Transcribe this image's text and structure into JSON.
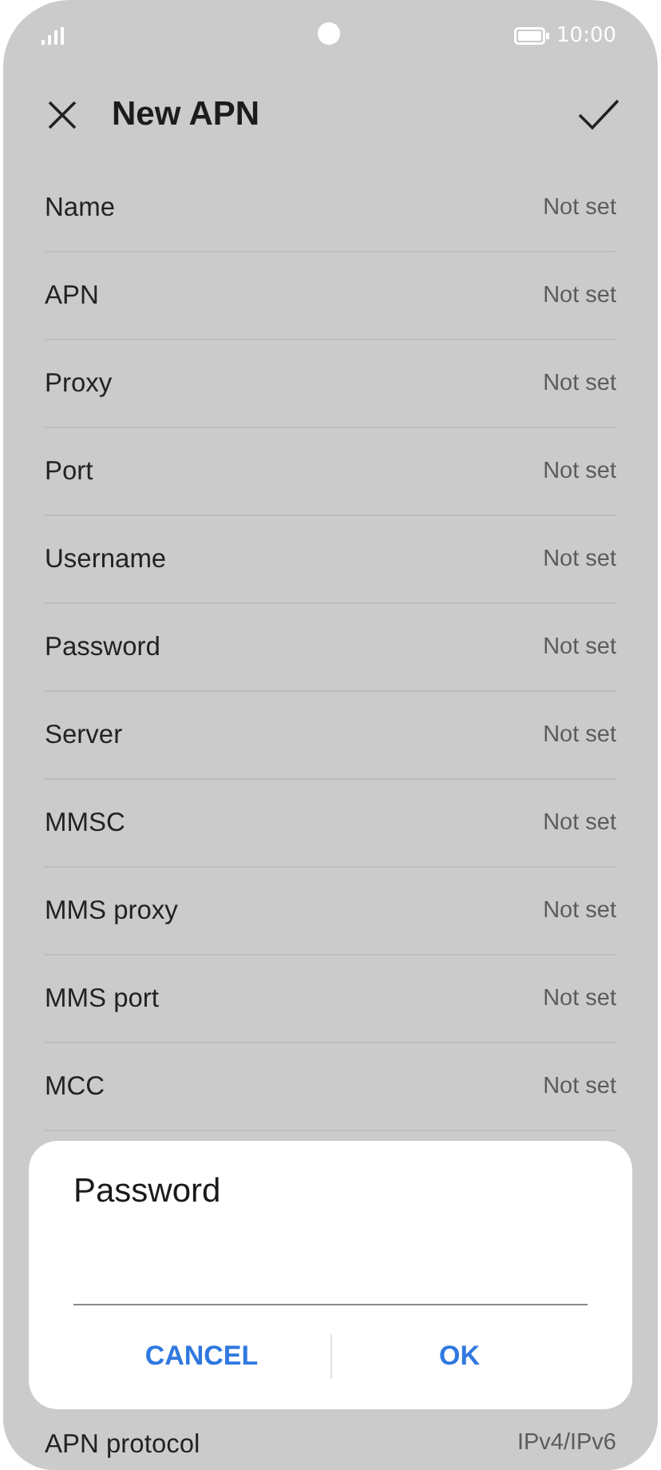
{
  "status_bar": {
    "time": "10:00"
  },
  "header": {
    "title": "New APN"
  },
  "rows": [
    {
      "label": "Name",
      "value": "Not set"
    },
    {
      "label": "APN",
      "value": "Not set"
    },
    {
      "label": "Proxy",
      "value": "Not set"
    },
    {
      "label": "Port",
      "value": "Not set"
    },
    {
      "label": "Username",
      "value": "Not set"
    },
    {
      "label": "Password",
      "value": "Not set"
    },
    {
      "label": "Server",
      "value": "Not set"
    },
    {
      "label": "MMSC",
      "value": "Not set"
    },
    {
      "label": "MMS proxy",
      "value": "Not set"
    },
    {
      "label": "MMS port",
      "value": "Not set"
    },
    {
      "label": "MCC",
      "value": "Not set"
    }
  ],
  "last_row": {
    "label": "APN protocol",
    "value": "IPv4/IPv6"
  },
  "dialog": {
    "title": "Password",
    "buttons": [
      "CANCEL",
      "OK"
    ]
  }
}
